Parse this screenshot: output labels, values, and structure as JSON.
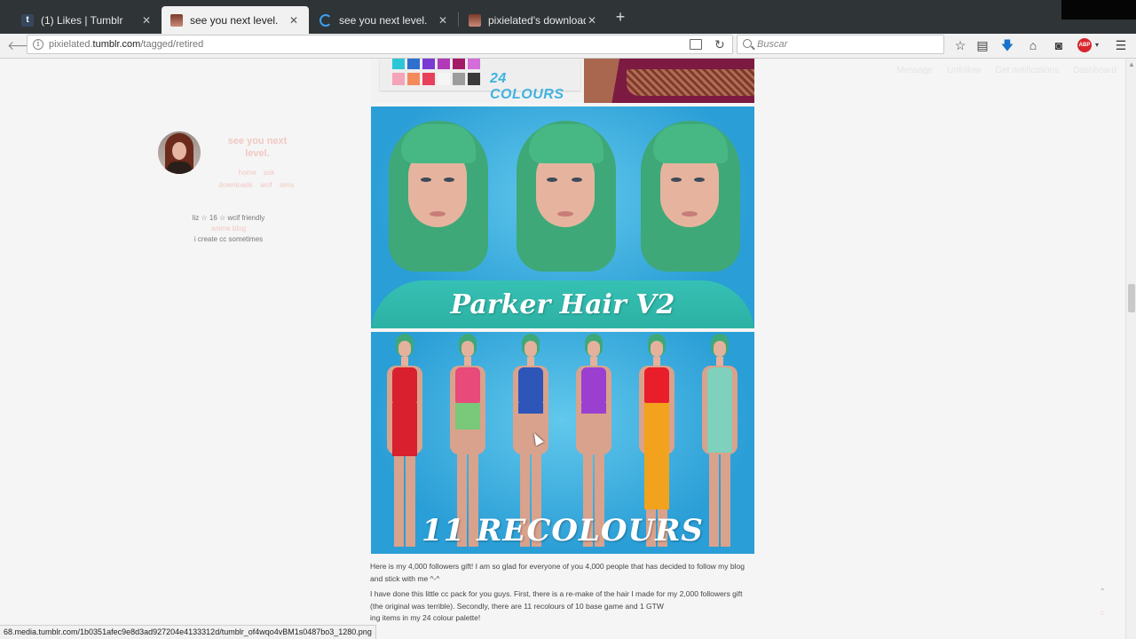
{
  "browser": {
    "tabs": [
      {
        "title": "(1) Likes | Tumblr",
        "favicon": "tumblr-icon"
      },
      {
        "title": "see you next level.",
        "favicon": "blog-avatar-icon"
      },
      {
        "title": "see you next level.",
        "favicon": "loading-icon"
      },
      {
        "title": "pixielated's downloads",
        "favicon": "blog-avatar-icon"
      }
    ],
    "active_tab": 1,
    "new_tab_label": "+",
    "url_prefix": "pixielated.",
    "url_domain": "tumblr.com",
    "url_path": "/tagged/retired",
    "search_placeholder": "Buscar",
    "abp_label": "ABP",
    "status_url": "68.media.tumblr.com/1b0351afec9e8d3ad927204e4133312d/tumblr_of4wqo4vBM1s0487bo3_1280.png"
  },
  "blog_actions": [
    "Message",
    "Unfollow",
    "Get notifications",
    "Dashboard"
  ],
  "sidebar": {
    "title_line1": "see you next",
    "title_line2": "level.",
    "nav_row1": [
      "home",
      "ask"
    ],
    "nav_row2": [
      "downloads",
      "wcif",
      "sims"
    ],
    "bio_line1": "liz ☆ 16 ☆ wcif friendly",
    "bio_line2": "anime blog",
    "bio_line3": "i create cc sometimes"
  },
  "post": {
    "colours_label": "24 COLOURS",
    "swatch_colors": [
      "#2cc7d6",
      "#2f6fd0",
      "#7a3ad4",
      "#b03ab8",
      "#a41a67",
      "#d36dd8",
      "#f4a4b8",
      "#f48a5c",
      "#e8405a",
      "#f5f5f5",
      "#9c9c9c",
      "#3a3a3a"
    ],
    "image1_title": "Parker Hair V2",
    "image2_title": "11 RECOLOURS",
    "paragraph1": "Here is my 4,000 followers gift! I am so glad for everyone of you 4,000 people that has decided to follow my blog and stick with me ^-^",
    "paragraph2": "I have done this little cc pack for you guys. First, there is a re-make of the hair I made for my 2,000 followers gift (the original was terrible). Secondly, there are 11 recolours of 10 base game and 1 GTW",
    "paragraph3": "ing items in my 24 colour palette!",
    "outfits": [
      {
        "top": "#d8202e",
        "bottom": "#d8202e",
        "bottom_len": 60
      },
      {
        "top": "#e84a7a",
        "bottom": "#7ac87a",
        "bottom_len": 30
      },
      {
        "top": "#2e55b8",
        "bottom": "#2e55b8",
        "bottom_len": 12
      },
      {
        "top": "#9b3fd0",
        "bottom": "#9b3fd0",
        "bottom_len": 12
      },
      {
        "top": "#e81e2a",
        "bottom": "#f2a21c",
        "bottom_len": 120
      },
      {
        "top": "#7fd0bc",
        "bottom": "#7fd0bc",
        "bottom_len": 56
      }
    ]
  }
}
